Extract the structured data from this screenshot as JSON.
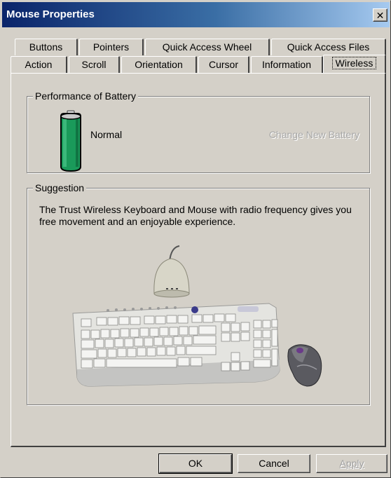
{
  "window": {
    "title": "Mouse Properties",
    "close_glyph": "✕"
  },
  "tabs_row1": [
    {
      "label": "Buttons"
    },
    {
      "label": "Pointers"
    },
    {
      "label": "Quick Access Wheel"
    },
    {
      "label": "Quick Access Files"
    }
  ],
  "tabs_row2": [
    {
      "label": "Action"
    },
    {
      "label": "Scroll"
    },
    {
      "label": "Orientation"
    },
    {
      "label": "Cursor"
    },
    {
      "label": "Information"
    },
    {
      "label": "Wireless",
      "active": true
    }
  ],
  "battery_group": {
    "label": "Performance of Battery",
    "status": "Normal",
    "change_label": "Change New Battery",
    "level_fraction": 1.0,
    "battery_color": "#1a9a5a",
    "icon": "battery-icon"
  },
  "suggestion_group": {
    "label": "Suggestion",
    "text": "The Trust Wireless Keyboard and Mouse with radio frequency gives you free movement and an enjoyable experience."
  },
  "buttons": {
    "ok": "OK",
    "cancel": "Cancel",
    "apply": "Apply"
  }
}
